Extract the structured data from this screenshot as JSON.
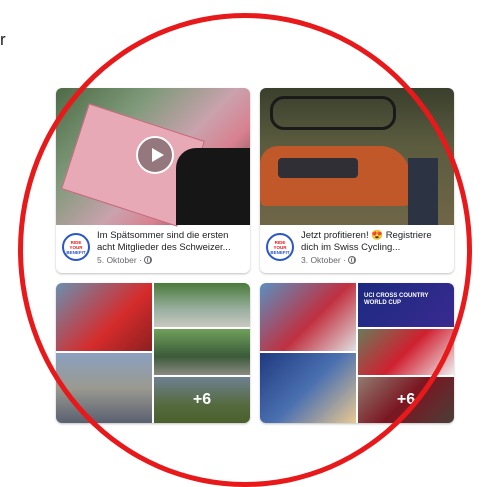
{
  "corner_text": "r",
  "posts": [
    {
      "text": "Im Spätsommer sind die ersten acht Mitglieder des Schweizer...",
      "date": "5. Oktober · ",
      "has_video": true,
      "avatar_lines": [
        "RIDE",
        "YOUR",
        "BENEFIT"
      ]
    },
    {
      "text": "Jetzt profitieren! 😍 Registriere dich im Swiss Cycling...",
      "date": "3. Oktober · ",
      "has_video": false,
      "avatar_lines": [
        "RIDE",
        "YOUR",
        "BENEFIT"
      ]
    }
  ],
  "galleries": [
    {
      "more_count": "+6"
    },
    {
      "more_count": "+6",
      "banner_text": "UCI CROSS COUNTRY WORLD CUP"
    }
  ],
  "colors": {
    "ring": "#e8191b",
    "avatar_ring": "#2a56c6",
    "meta_gray": "#65676b"
  }
}
